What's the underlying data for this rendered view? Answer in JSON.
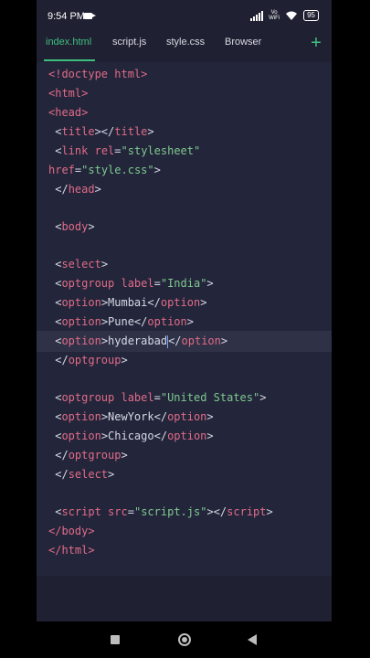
{
  "status": {
    "time": "9:54 PM",
    "vowifi_top": "Vo",
    "vowifi_bottom": "WiFi",
    "battery": "95"
  },
  "tabs": [
    {
      "label": "index.html"
    },
    {
      "label": "script.js"
    },
    {
      "label": "style.css"
    },
    {
      "label": "Browser"
    }
  ],
  "add_tab_label": "+",
  "code": {
    "l1": "<!doctype html>",
    "l2": "<html>",
    "l3": "<head>",
    "l4a": " <",
    "l4b": "title",
    "l4c": "></",
    "l4d": "title",
    "l4e": ">",
    "l5a": " <",
    "l5b": "link",
    "l5c": " ",
    "l5d": "rel",
    "l5e": "=",
    "l5f": "\"stylesheet\"",
    "l6a": "href",
    "l6b": "=",
    "l6c": "\"style.css\"",
    "l6d": ">",
    "l7a": " </",
    "l7b": "head",
    "l7c": ">",
    "l8a": " <",
    "l8b": "body",
    "l8c": ">",
    "l9a": " <",
    "l9b": "select",
    "l9c": ">",
    "l10a": " <",
    "l10b": "optgroup",
    "l10c": " ",
    "l10d": "label",
    "l10e": "=",
    "l10f": "\"India\"",
    "l10g": ">",
    "l11a": " <",
    "l11b": "option",
    "l11c": ">Mumbai</",
    "l11d": "option",
    "l11e": ">",
    "l12a": " <",
    "l12b": "option",
    "l12c": ">Pune</",
    "l12d": "option",
    "l12e": ">",
    "l13a": " <",
    "l13b": "option",
    "l13c": ">hyderabad",
    "l13d": "</",
    "l13e": "option",
    "l13f": ">",
    "l14a": " </",
    "l14b": "optgroup",
    "l14c": ">",
    "l15a": " <",
    "l15b": "optgroup",
    "l15c": " ",
    "l15d": "label",
    "l15e": "=",
    "l15f": "\"United States\"",
    "l15g": ">",
    "l16a": " <",
    "l16b": "option",
    "l16c": ">NewYork</",
    "l16d": "option",
    "l16e": ">",
    "l17a": " <",
    "l17b": "option",
    "l17c": ">Chicago</",
    "l17d": "option",
    "l17e": ">",
    "l18a": " </",
    "l18b": "optgroup",
    "l18c": ">",
    "l19a": " </",
    "l19b": "select",
    "l19c": ">",
    "l20a": " <",
    "l20b": "script",
    "l20c": " ",
    "l20d": "src",
    "l20e": "=",
    "l20f": "\"script.js\"",
    "l20g": "></",
    "l20h": "script",
    "l20i": ">",
    "l21": "</body>",
    "l22": "</html>"
  },
  "colors": {
    "accent": "#3fbf7f",
    "tag": "#e06c88",
    "string": "#7ec98f",
    "editor_bg": "#23253a"
  }
}
